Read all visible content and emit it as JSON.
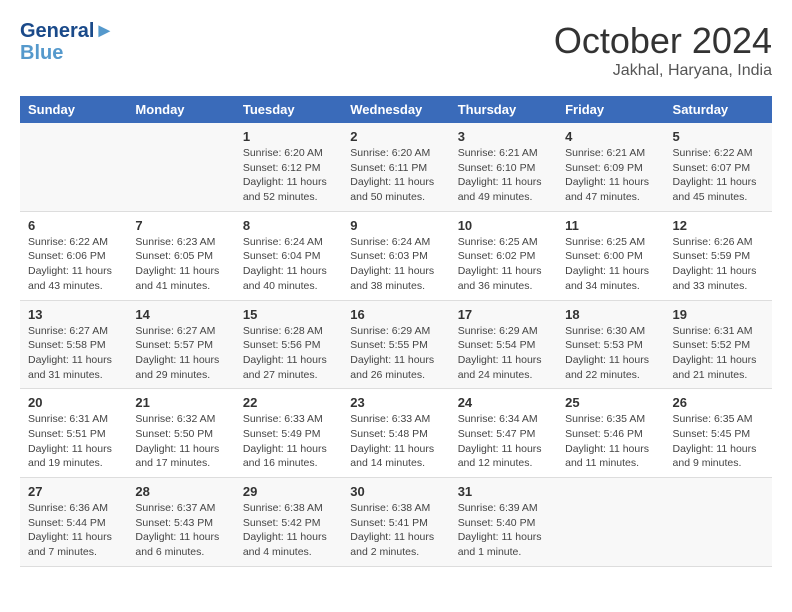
{
  "header": {
    "logo_line1": "General",
    "logo_line2": "Blue",
    "month": "October 2024",
    "location": "Jakhal, Haryana, India"
  },
  "weekdays": [
    "Sunday",
    "Monday",
    "Tuesday",
    "Wednesday",
    "Thursday",
    "Friday",
    "Saturday"
  ],
  "weeks": [
    [
      {
        "day": "",
        "info": ""
      },
      {
        "day": "",
        "info": ""
      },
      {
        "day": "1",
        "info": "Sunrise: 6:20 AM\nSunset: 6:12 PM\nDaylight: 11 hours\nand 52 minutes."
      },
      {
        "day": "2",
        "info": "Sunrise: 6:20 AM\nSunset: 6:11 PM\nDaylight: 11 hours\nand 50 minutes."
      },
      {
        "day": "3",
        "info": "Sunrise: 6:21 AM\nSunset: 6:10 PM\nDaylight: 11 hours\nand 49 minutes."
      },
      {
        "day": "4",
        "info": "Sunrise: 6:21 AM\nSunset: 6:09 PM\nDaylight: 11 hours\nand 47 minutes."
      },
      {
        "day": "5",
        "info": "Sunrise: 6:22 AM\nSunset: 6:07 PM\nDaylight: 11 hours\nand 45 minutes."
      }
    ],
    [
      {
        "day": "6",
        "info": "Sunrise: 6:22 AM\nSunset: 6:06 PM\nDaylight: 11 hours\nand 43 minutes."
      },
      {
        "day": "7",
        "info": "Sunrise: 6:23 AM\nSunset: 6:05 PM\nDaylight: 11 hours\nand 41 minutes."
      },
      {
        "day": "8",
        "info": "Sunrise: 6:24 AM\nSunset: 6:04 PM\nDaylight: 11 hours\nand 40 minutes."
      },
      {
        "day": "9",
        "info": "Sunrise: 6:24 AM\nSunset: 6:03 PM\nDaylight: 11 hours\nand 38 minutes."
      },
      {
        "day": "10",
        "info": "Sunrise: 6:25 AM\nSunset: 6:02 PM\nDaylight: 11 hours\nand 36 minutes."
      },
      {
        "day": "11",
        "info": "Sunrise: 6:25 AM\nSunset: 6:00 PM\nDaylight: 11 hours\nand 34 minutes."
      },
      {
        "day": "12",
        "info": "Sunrise: 6:26 AM\nSunset: 5:59 PM\nDaylight: 11 hours\nand 33 minutes."
      }
    ],
    [
      {
        "day": "13",
        "info": "Sunrise: 6:27 AM\nSunset: 5:58 PM\nDaylight: 11 hours\nand 31 minutes."
      },
      {
        "day": "14",
        "info": "Sunrise: 6:27 AM\nSunset: 5:57 PM\nDaylight: 11 hours\nand 29 minutes."
      },
      {
        "day": "15",
        "info": "Sunrise: 6:28 AM\nSunset: 5:56 PM\nDaylight: 11 hours\nand 27 minutes."
      },
      {
        "day": "16",
        "info": "Sunrise: 6:29 AM\nSunset: 5:55 PM\nDaylight: 11 hours\nand 26 minutes."
      },
      {
        "day": "17",
        "info": "Sunrise: 6:29 AM\nSunset: 5:54 PM\nDaylight: 11 hours\nand 24 minutes."
      },
      {
        "day": "18",
        "info": "Sunrise: 6:30 AM\nSunset: 5:53 PM\nDaylight: 11 hours\nand 22 minutes."
      },
      {
        "day": "19",
        "info": "Sunrise: 6:31 AM\nSunset: 5:52 PM\nDaylight: 11 hours\nand 21 minutes."
      }
    ],
    [
      {
        "day": "20",
        "info": "Sunrise: 6:31 AM\nSunset: 5:51 PM\nDaylight: 11 hours\nand 19 minutes."
      },
      {
        "day": "21",
        "info": "Sunrise: 6:32 AM\nSunset: 5:50 PM\nDaylight: 11 hours\nand 17 minutes."
      },
      {
        "day": "22",
        "info": "Sunrise: 6:33 AM\nSunset: 5:49 PM\nDaylight: 11 hours\nand 16 minutes."
      },
      {
        "day": "23",
        "info": "Sunrise: 6:33 AM\nSunset: 5:48 PM\nDaylight: 11 hours\nand 14 minutes."
      },
      {
        "day": "24",
        "info": "Sunrise: 6:34 AM\nSunset: 5:47 PM\nDaylight: 11 hours\nand 12 minutes."
      },
      {
        "day": "25",
        "info": "Sunrise: 6:35 AM\nSunset: 5:46 PM\nDaylight: 11 hours\nand 11 minutes."
      },
      {
        "day": "26",
        "info": "Sunrise: 6:35 AM\nSunset: 5:45 PM\nDaylight: 11 hours\nand 9 minutes."
      }
    ],
    [
      {
        "day": "27",
        "info": "Sunrise: 6:36 AM\nSunset: 5:44 PM\nDaylight: 11 hours\nand 7 minutes."
      },
      {
        "day": "28",
        "info": "Sunrise: 6:37 AM\nSunset: 5:43 PM\nDaylight: 11 hours\nand 6 minutes."
      },
      {
        "day": "29",
        "info": "Sunrise: 6:38 AM\nSunset: 5:42 PM\nDaylight: 11 hours\nand 4 minutes."
      },
      {
        "day": "30",
        "info": "Sunrise: 6:38 AM\nSunset: 5:41 PM\nDaylight: 11 hours\nand 2 minutes."
      },
      {
        "day": "31",
        "info": "Sunrise: 6:39 AM\nSunset: 5:40 PM\nDaylight: 11 hours\nand 1 minute."
      },
      {
        "day": "",
        "info": ""
      },
      {
        "day": "",
        "info": ""
      }
    ]
  ]
}
